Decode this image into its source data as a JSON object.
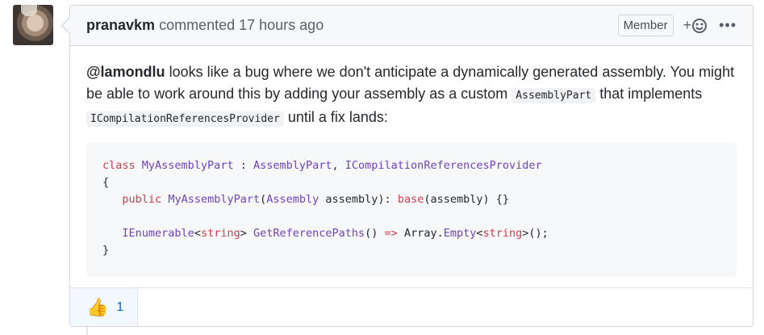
{
  "comment": {
    "author": "pranavkm",
    "action": "commented",
    "time": "17 hours ago",
    "role_badge": "Member",
    "react_button_label": "+",
    "more_label": "•••",
    "body": {
      "mention": "@lamondlu",
      "text1": " looks like a bug where we don't anticipate a dynamically generated assembly. You might be able to work around this by adding your assembly as a custom ",
      "code1": "AssemblyPart",
      "text2": " that implements ",
      "code2": "ICompilationReferencesProvider",
      "text3": " until a fix lands:"
    },
    "code_lines": {
      "l1_kw": "class",
      "l1_type": "MyAssemblyPart",
      "l1_sep": " : ",
      "l1_base1": "AssemblyPart",
      "l1_comma": ", ",
      "l1_base2": "ICompilationReferencesProvider",
      "l2": "{",
      "l3_kw": "public",
      "l3_type": "MyAssemblyPart",
      "l3_paren": "(",
      "l3_argtype": "Assembly",
      "l3_rest": " assembly): ",
      "l3_base": "base",
      "l3_end": "(assembly) {}",
      "l5_type": "IEnumerable",
      "l5_lt": "<",
      "l5_gen": "string",
      "l5_gt": "> ",
      "l5_method": "GetReferencePaths",
      "l5_call": "() ",
      "l5_arrow": "=>",
      "l5_arr": " Array.",
      "l5_empty": "Empty",
      "l5_lt2": "<",
      "l5_gen2": "string",
      "l5_tail": ">();",
      "l6": "}"
    },
    "reactions": [
      {
        "icon": "thumbs-up-icon",
        "emoji": "👍",
        "count": "1"
      }
    ]
  }
}
